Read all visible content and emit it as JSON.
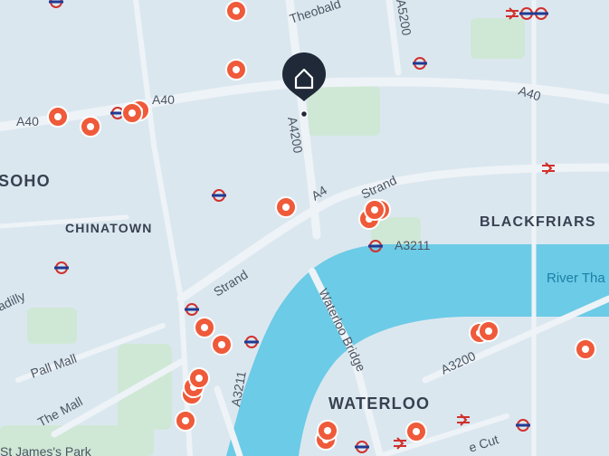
{
  "map": {
    "districts": [
      "SOHO",
      "CHINATOWN",
      "BLACKFRIARS",
      "WATERLOO"
    ],
    "roads": [
      "A40",
      "A40",
      "A40",
      "A4200",
      "A5200",
      "A4",
      "Strand",
      "Strand",
      "A3211",
      "A3211",
      "A3200",
      "Waterloo Bridge",
      "Pall Mall",
      "The Mall",
      "Theobald",
      "adilly",
      "e Cut",
      "St James's Park"
    ],
    "water": [
      "River Tha"
    ],
    "home_icon": "home-icon",
    "marker_icon": "location-marker-icon",
    "transit_icon": "underground-roundel-icon",
    "rail_icon": "national-rail-icon",
    "colors": {
      "land": "#dbe7ef",
      "roads": "#eef3f7",
      "parks": "#cfe8d6",
      "river": "#6ccbe6",
      "marker": "#ef5a3a",
      "home_pin": "#1f2937"
    }
  }
}
